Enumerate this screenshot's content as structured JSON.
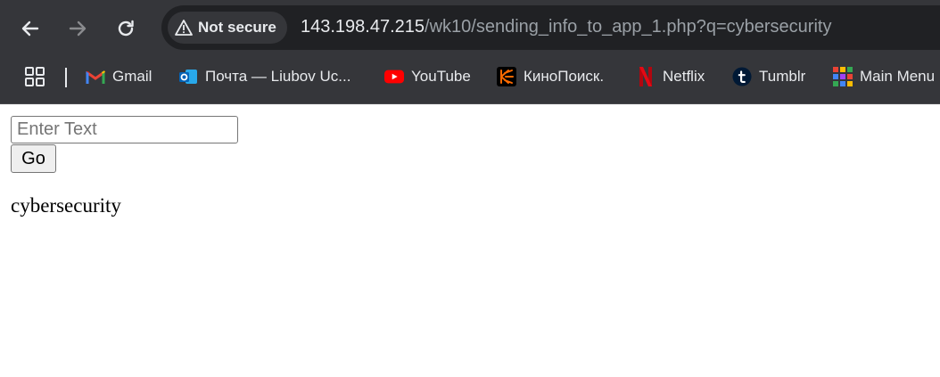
{
  "browser": {
    "security_chip": {
      "icon": "warning-triangle-icon",
      "label": "Not secure"
    },
    "address": {
      "host": "143.198.47.215",
      "path": "/wk10/sending_info_to_app_1.php?q=cybersecurity"
    },
    "nav_icons": [
      "back-arrow-icon",
      "forward-arrow-icon",
      "reload-icon"
    ],
    "bookmarks": [
      {
        "icon": "gmail-icon",
        "label": "Gmail"
      },
      {
        "icon": "outlook-icon",
        "label": "Почта — Liubov Uc..."
      },
      {
        "icon": "youtube-icon",
        "label": "YouTube"
      },
      {
        "icon": "kinopoisk-icon",
        "label": "КиноПоиск."
      },
      {
        "icon": "netflix-icon",
        "label": "Netflix"
      },
      {
        "icon": "tumblr-icon",
        "label": "Tumblr"
      },
      {
        "icon": "grid-menu-icon",
        "label": "Main Menu"
      }
    ]
  },
  "page": {
    "input": {
      "placeholder": "Enter Text",
      "value": ""
    },
    "go_label": "Go",
    "result_text": "cybersecurity"
  }
}
